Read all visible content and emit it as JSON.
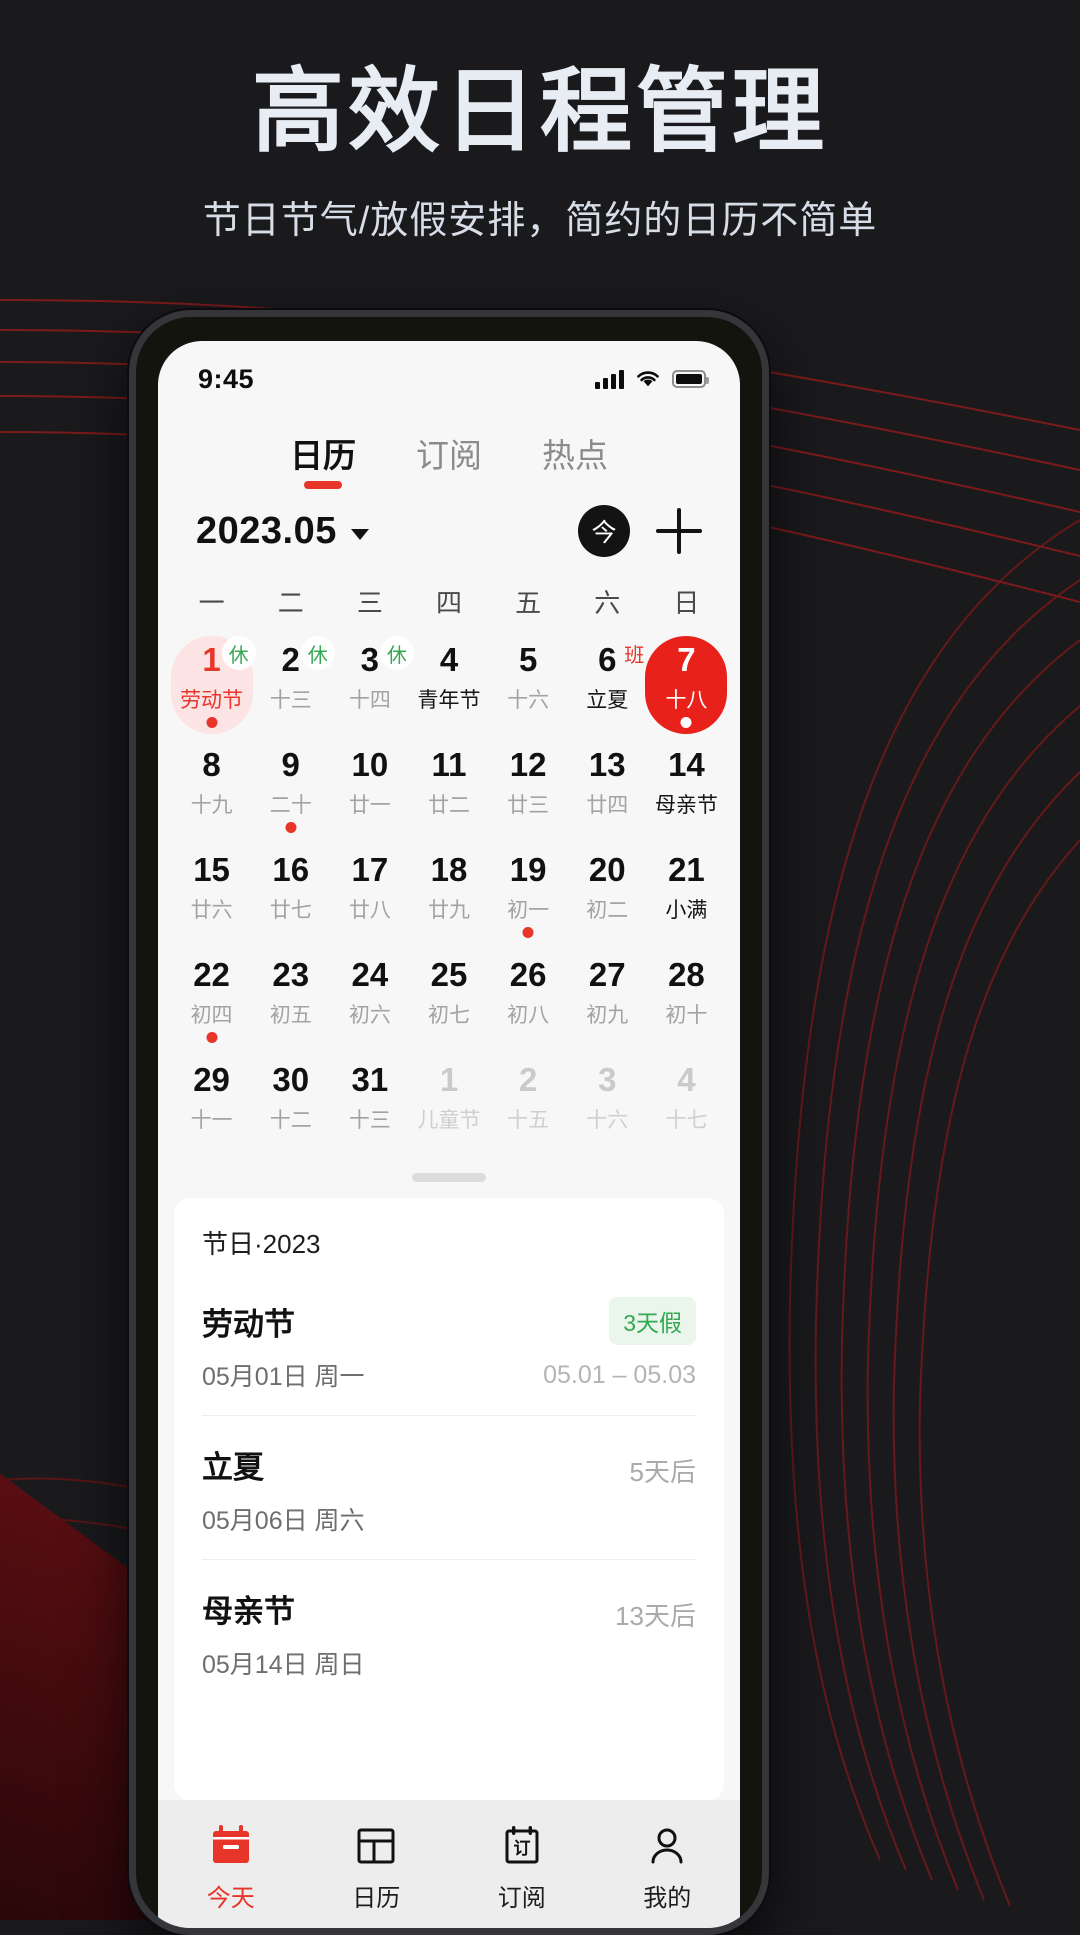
{
  "promo": {
    "headline": "高效日程管理",
    "subheadline": "节日节气/放假安排，简约的日历不简单"
  },
  "statusbar": {
    "time": "9:45",
    "signal_icon": "cellular-bars-icon",
    "wifi_icon": "wifi-icon",
    "battery_icon": "battery-full-icon"
  },
  "top_tabs": [
    {
      "label": "日历",
      "active": true
    },
    {
      "label": "订阅",
      "active": false
    },
    {
      "label": "热点",
      "active": false
    }
  ],
  "month_bar": {
    "title": "2023.05",
    "caret_icon": "chevron-down-icon",
    "today_label": "今",
    "add_icon": "plus-icon"
  },
  "calendar": {
    "weekday_headers": [
      "一",
      "二",
      "三",
      "四",
      "五",
      "六",
      "日"
    ],
    "weeks": [
      [
        {
          "day": "1",
          "lunar": "劳动节",
          "holiday": true,
          "blob": true,
          "badge": "休",
          "badge_type": "rest",
          "dot": "red"
        },
        {
          "day": "2",
          "lunar": "十三",
          "badge": "休",
          "badge_type": "rest"
        },
        {
          "day": "3",
          "lunar": "十四",
          "badge": "休",
          "badge_type": "rest"
        },
        {
          "day": "4",
          "lunar": "青年节",
          "festival": true
        },
        {
          "day": "5",
          "lunar": "十六"
        },
        {
          "day": "6",
          "lunar": "立夏",
          "festival": true,
          "badge": "班",
          "badge_type": "work"
        },
        {
          "day": "7",
          "lunar": "十八",
          "selected": true,
          "dot": "white"
        }
      ],
      [
        {
          "day": "8",
          "lunar": "十九"
        },
        {
          "day": "9",
          "lunar": "二十",
          "dot": "red"
        },
        {
          "day": "10",
          "lunar": "廿一"
        },
        {
          "day": "11",
          "lunar": "廿二"
        },
        {
          "day": "12",
          "lunar": "廿三"
        },
        {
          "day": "13",
          "lunar": "廿四"
        },
        {
          "day": "14",
          "lunar": "母亲节",
          "festival": true
        }
      ],
      [
        {
          "day": "15",
          "lunar": "廿六"
        },
        {
          "day": "16",
          "lunar": "廿七"
        },
        {
          "day": "17",
          "lunar": "廿八"
        },
        {
          "day": "18",
          "lunar": "廿九"
        },
        {
          "day": "19",
          "lunar": "初一",
          "dot": "red"
        },
        {
          "day": "20",
          "lunar": "初二"
        },
        {
          "day": "21",
          "lunar": "小满",
          "festival": true
        }
      ],
      [
        {
          "day": "22",
          "lunar": "初四",
          "dot": "red"
        },
        {
          "day": "23",
          "lunar": "初五"
        },
        {
          "day": "24",
          "lunar": "初六"
        },
        {
          "day": "25",
          "lunar": "初七"
        },
        {
          "day": "26",
          "lunar": "初八"
        },
        {
          "day": "27",
          "lunar": "初九"
        },
        {
          "day": "28",
          "lunar": "初十"
        }
      ],
      [
        {
          "day": "29",
          "lunar": "十一"
        },
        {
          "day": "30",
          "lunar": "十二"
        },
        {
          "day": "31",
          "lunar": "十三"
        },
        {
          "day": "1",
          "lunar": "儿童节",
          "muted": true
        },
        {
          "day": "2",
          "lunar": "十五",
          "muted": true
        },
        {
          "day": "3",
          "lunar": "十六",
          "muted": true
        },
        {
          "day": "4",
          "lunar": "十七",
          "muted": true
        }
      ]
    ]
  },
  "holiday_card": {
    "title": "节日·2023",
    "rows": [
      {
        "name": "劳动节",
        "badge": "3天假",
        "badge_type": "holiday",
        "date": "05月01日 周一",
        "range": "05.01 – 05.03"
      },
      {
        "name": "立夏",
        "away": "5天后",
        "date": "05月06日 周六"
      },
      {
        "name": "母亲节",
        "away": "13天后",
        "date": "05月14日 周日"
      }
    ]
  },
  "bottom_nav": [
    {
      "label": "今天",
      "icon": "calendar-today-icon",
      "active": true
    },
    {
      "label": "日历",
      "icon": "calendar-grid-icon",
      "active": false
    },
    {
      "label": "订阅",
      "icon": "subscribe-icon",
      "active": false
    },
    {
      "label": "我的",
      "icon": "user-profile-icon",
      "active": false
    }
  ],
  "colors": {
    "accent_red": "#e8352a",
    "selected_red": "#e8221a",
    "rest_green": "#34a853",
    "promo_bg": "#1a1a1d",
    "headline": "#e8edf4"
  }
}
